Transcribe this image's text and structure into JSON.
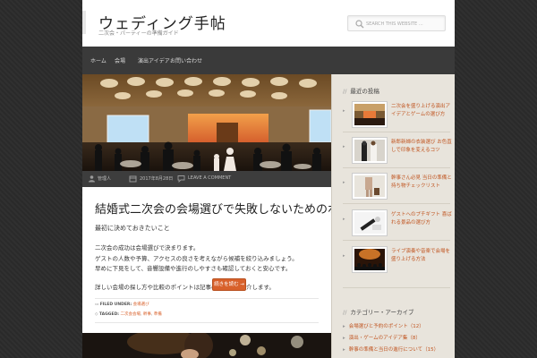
{
  "header": {
    "site_title": "ウェディング手帖",
    "site_description": "二次会・パーティーの準備ガイド",
    "search_placeholder": "SEARCH THIS WEBSITE …"
  },
  "nav": {
    "items": [
      {
        "label": "ホーム"
      },
      {
        "label": "会場"
      },
      {
        "label": "演出アイデア"
      },
      {
        "label": "お問い合わせ"
      }
    ]
  },
  "post": {
    "meta": {
      "author": "管理人",
      "date": "2017年8月28日",
      "comments": "LEAVE A COMMENT"
    },
    "title": "結婚式二次会の会場選びで失敗しないためのポイント",
    "subtitle": "最初に決めておきたいこと",
    "body_lines": [
      "二次会の成功は会場選びで決まります。",
      "ゲストの人数や予算、アクセスの良さを考えながら候補を絞り込みましょう。",
      "早めに下見をして、音響設備や進行のしやすさも確認しておくと安心です。"
    ],
    "readmore_line": "詳しい会場の探し方や比較のポイントは記事の続きでご紹介します。",
    "readmore_label": "続きを読む →",
    "filed_label": "FILED UNDER:",
    "filed_value": "会場選び",
    "tagged_label": "TAGGED:",
    "tags": [
      "二次会会場",
      "幹事",
      "準備"
    ]
  },
  "sidebar": {
    "recent_title": "最近の投稿",
    "recent_posts": [
      {
        "title": "二次会を盛り上げる演出アイデアとゲームの選び方"
      },
      {
        "title": "新郎新婦の衣装選び お色直しで印象を変えるコツ"
      },
      {
        "title": "幹事さん必見 当日の準備と持ち物チェックリスト"
      },
      {
        "title": "ゲストへのプチギフト 喜ばれる景品の選び方"
      },
      {
        "title": "ライブ演奏や音楽で会場を盛り上げる方法"
      }
    ],
    "categories_title": "カテゴリー・アーカイブ",
    "categories": [
      {
        "label": "会場選びと予約のポイント（12）"
      },
      {
        "label": "演出・ゲームのアイデア集（8）"
      },
      {
        "label": "幹事の準備と当日の進行について（15）"
      }
    ]
  },
  "colors": {
    "accent": "#d8612b",
    "link": "#c0541f",
    "nav_bg": "#3a3a3a",
    "sidebar_bg": "#e8e4dc"
  }
}
